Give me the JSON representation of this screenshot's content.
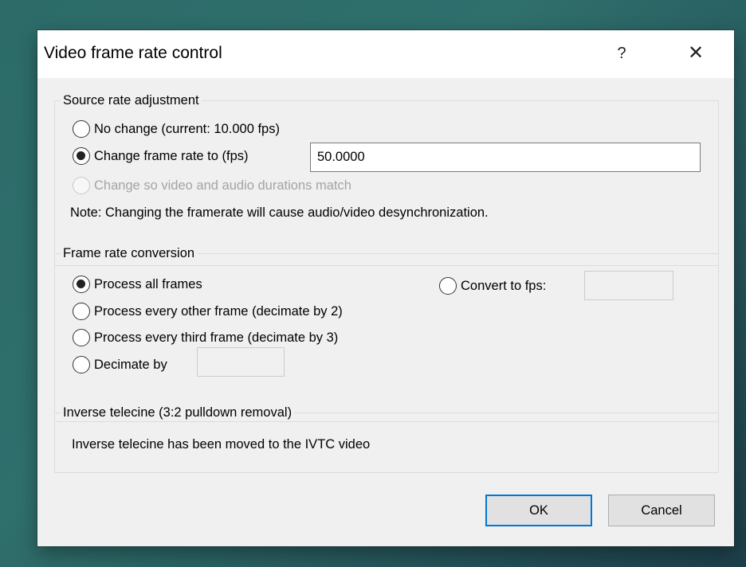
{
  "dialog": {
    "title": "Video frame rate control",
    "help_icon": "?",
    "close_icon": "✕"
  },
  "source_rate": {
    "title": "Source rate adjustment",
    "no_change_label": "No change (current: 10.000 fps)",
    "change_rate_label": "Change frame rate to (fps)",
    "change_rate_value": "50.0000",
    "match_durations_label": "Change so video and audio durations match",
    "note": "Note: Changing the framerate will cause audio/video desynchronization.",
    "selected": "change_rate"
  },
  "conversion": {
    "title": "Frame rate conversion",
    "process_all_label": "Process all frames",
    "every_other_label": "Process every other frame (decimate by 2)",
    "every_third_label": "Process every third frame (decimate by 3)",
    "decimate_by_label": "Decimate by",
    "decimate_by_value": "",
    "convert_to_label": "Convert to fps:",
    "convert_to_value": "",
    "selected": "process_all"
  },
  "ivtc": {
    "title": "Inverse telecine (3:2 pulldown removal)",
    "text": "Inverse telecine has been moved to the IVTC video"
  },
  "buttons": {
    "ok_label": "OK",
    "cancel_label": "Cancel"
  },
  "colors": {
    "dialog_bg": "#f0f0f0",
    "titlebar_bg": "#ffffff",
    "default_button_border": "#0078d7",
    "desktop_bg": "#2c6b68"
  }
}
